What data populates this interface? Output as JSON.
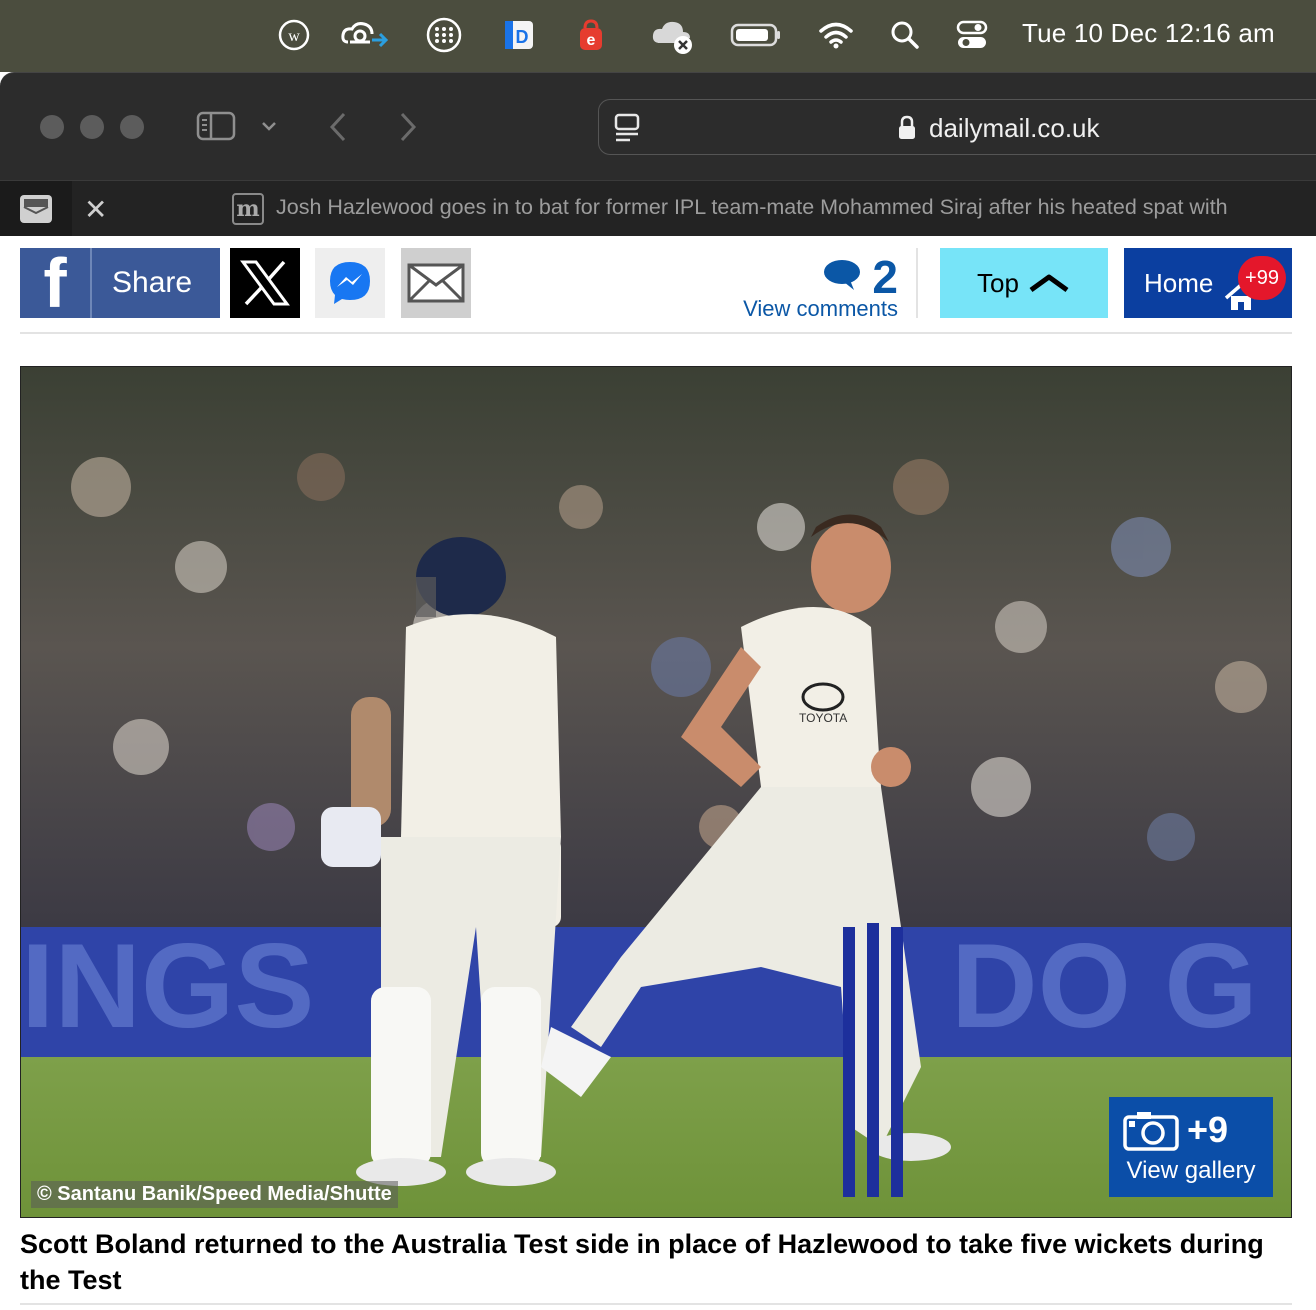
{
  "menubar": {
    "icons": [
      "wikipedia-icon",
      "creative-cloud-icon",
      "launchpad-grid-icon",
      "dictionary-app-icon",
      "browser-extension-icon",
      "cloud-sync-error-icon",
      "battery-icon",
      "wifi-icon",
      "spotlight-search-icon",
      "control-center-icon"
    ],
    "clock": "Tue 10 Dec  12:16 am"
  },
  "browser": {
    "url": "dailymail.co.uk",
    "tab_title": "Josh Hazlewood goes in to bat for former IPL team-mate Mohammed Siraj after his heated spat with"
  },
  "sharebar": {
    "facebook_label": "Share",
    "comment_count": "2",
    "comments_label": "View comments",
    "top_label": "Top",
    "home_label": "Home",
    "home_badge": "+99",
    "colors": {
      "facebook": "#3b5998",
      "top": "#77e4f8",
      "home": "#0b3fa0",
      "accent": "#0b57a6"
    }
  },
  "article": {
    "image_credit": "© Santanu Banik/Speed Media/Shutte",
    "gallery_count": "+9",
    "gallery_label": "View gallery",
    "caption": "Scott Boland returned to the Australia Test side in place of Hazlewood to take five wickets during the Test"
  }
}
